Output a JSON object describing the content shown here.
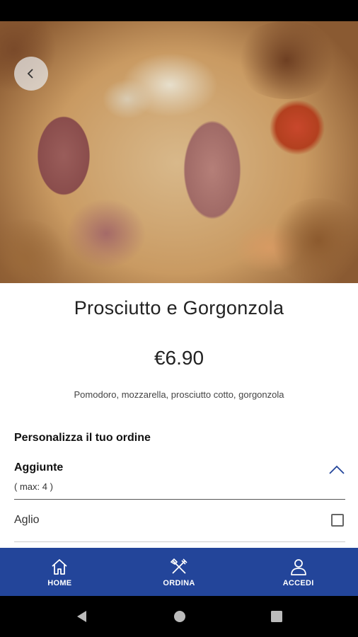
{
  "product": {
    "name": "Prosciutto e Gorgonzola",
    "price": "€6.90",
    "description": "Pomodoro, mozzarella, prosciutto cotto, gorgonzola"
  },
  "customize": {
    "title": "Personalizza il tuo ordine",
    "group": {
      "title": "Aggiunte",
      "subtitle": "( max: 4 )",
      "expanded": true,
      "options": [
        {
          "label": "Aglio",
          "checked": false
        }
      ]
    }
  },
  "bottom_nav": {
    "items": [
      {
        "label": "HOME",
        "icon": "home-icon"
      },
      {
        "label": "ORDINA",
        "icon": "utensils-icon"
      },
      {
        "label": "ACCEDI",
        "icon": "user-icon"
      }
    ]
  },
  "colors": {
    "nav_background": "#23459a",
    "accent": "#23459a"
  }
}
